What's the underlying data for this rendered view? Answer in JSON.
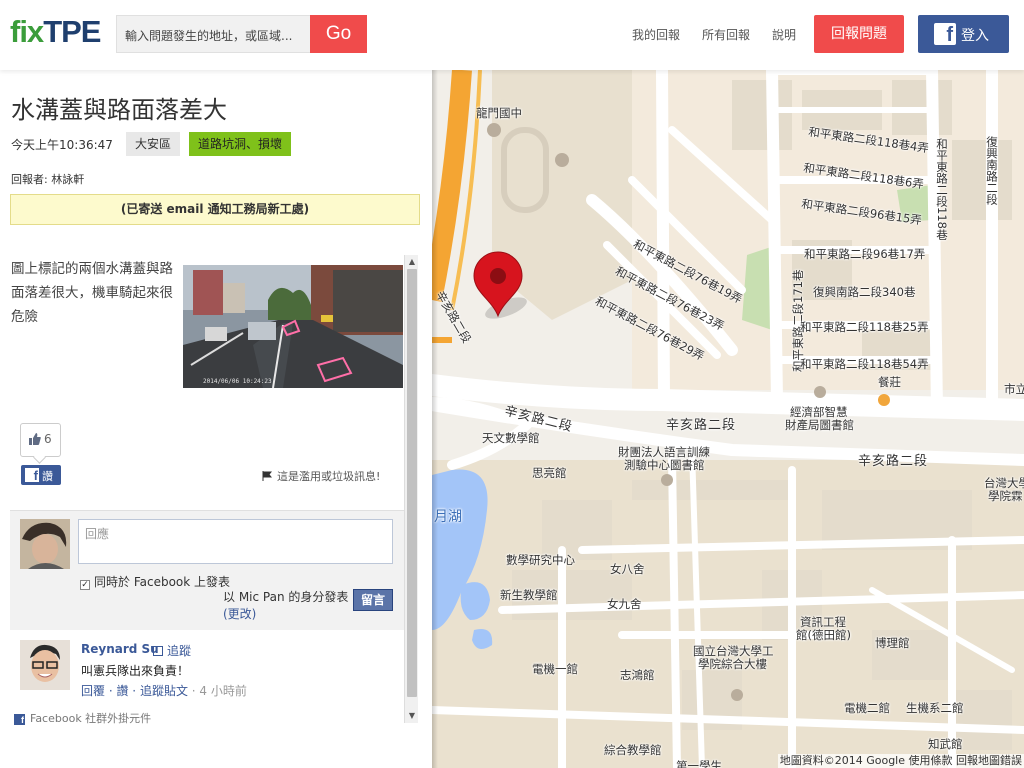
{
  "header": {
    "logo_fix": "fix",
    "logo_tpe": "TPE",
    "search_placeholder": "輸入問題發生的地址，或區域...",
    "go_label": "Go",
    "nav": [
      "我的回報",
      "所有回報",
      "說明"
    ],
    "report_label": "回報問題",
    "fb_login_label": "登入",
    "colors": {
      "red": "#f04b4b",
      "facebook": "#3b5998",
      "logo_green": "#3b9d3b",
      "logo_navy": "#1f3f6e"
    }
  },
  "issue": {
    "title": "水溝蓋與路面落差大",
    "time": "今天上午10:36:47",
    "district": "大安區",
    "category": "道路坑洞、損壞",
    "category_color": "#7fc11a",
    "reporter": "回報者: 林詠軒",
    "notice": "(已寄送 email 通知工務局新工處)",
    "description": "圖上標記的兩個水溝蓋與路面落差很大，機車騎起來很危險",
    "photo_timestamp": "2014/06/06 10:24:23"
  },
  "social": {
    "like_count": "6",
    "share_label": "讚",
    "flag_label": "這是濫用或垃圾訊息!"
  },
  "comments": {
    "input_placeholder": "回應",
    "also_post_label": "同時於 Facebook 上發表",
    "also_post_checked": true,
    "post_as_prefix": "以 Mic Pan 的身分發表",
    "post_as_change": "(更改)",
    "post_button": "留言",
    "items": [
      {
        "author": "Reynard Su",
        "follow": "追蹤",
        "text": "叫憲兵隊出來負責！",
        "reply": "回覆",
        "like": "讚",
        "follow_post": "追蹤貼文",
        "time": "4 小時前"
      }
    ],
    "plugin_label": "Facebook 社群外掛元件"
  },
  "map": {
    "labels": {
      "school": "龍門國中",
      "xinhai_vertical": "辛亥路二段",
      "heping_118_4": "和平東路二段118巷4弄",
      "heping_118_6": "和平東路二段118巷6弄",
      "heping_96_15": "和平東路二段96巷15弄",
      "heping_96_17": "和平東路二段96巷17弄",
      "heping_76_19": "和平東路二段76巷19弄",
      "heping_76_23": "和平東路二段76巷23弄",
      "heping_76_29": "和平東路二段76巷29弄",
      "heping_171": "和平東路二段171巷",
      "fuxing_340": "復興南路二段340巷",
      "heping_118_25": "和平東路二段118巷25弄",
      "heping_118_54": "和平東路二段118巷54弄",
      "heping_118_vertical": "和平東路二段118巷",
      "fuxing_vertical": "復興南路二段",
      "canzhuang": "餐莊",
      "ip_office_1": "經濟部智慧",
      "ip_office_2": "財產局圖書館",
      "xinhai_1": "辛亥路二段",
      "xinhai_2": "辛亥路二段",
      "xinhai_3": "辛亥路二段",
      "observatory": "天文數學館",
      "lang_center_1": "財團法人語言訓練",
      "lang_center_2": "測驗中心圖書館",
      "siliang": "思亮館",
      "ntu_1": "台灣大學",
      "ntu_2": "學院霖",
      "shili": "市立",
      "yuehu": "月湖",
      "math_center": "數學研究中心",
      "new_classroom": "新生教學館",
      "nv4": "女八舍",
      "nv9": "女九舍",
      "csie_1": "資訊工程",
      "csie_2": "館(德田館)",
      "bolo": "博理館",
      "eng_1": "國立台灣大學工",
      "eng_2": "學院綜合大樓",
      "ee1": "電機一館",
      "zhihong": "志鴻館",
      "ee2": "電機二館",
      "biosys2": "生機系二館",
      "general_classroom": "綜合教學館",
      "zhiwu": "知武館",
      "first_classroom": "第一學生"
    },
    "footer": "地圖資料©2014 Google   使用條款   回報地圖錯誤",
    "marker_color": "#d7141e"
  }
}
